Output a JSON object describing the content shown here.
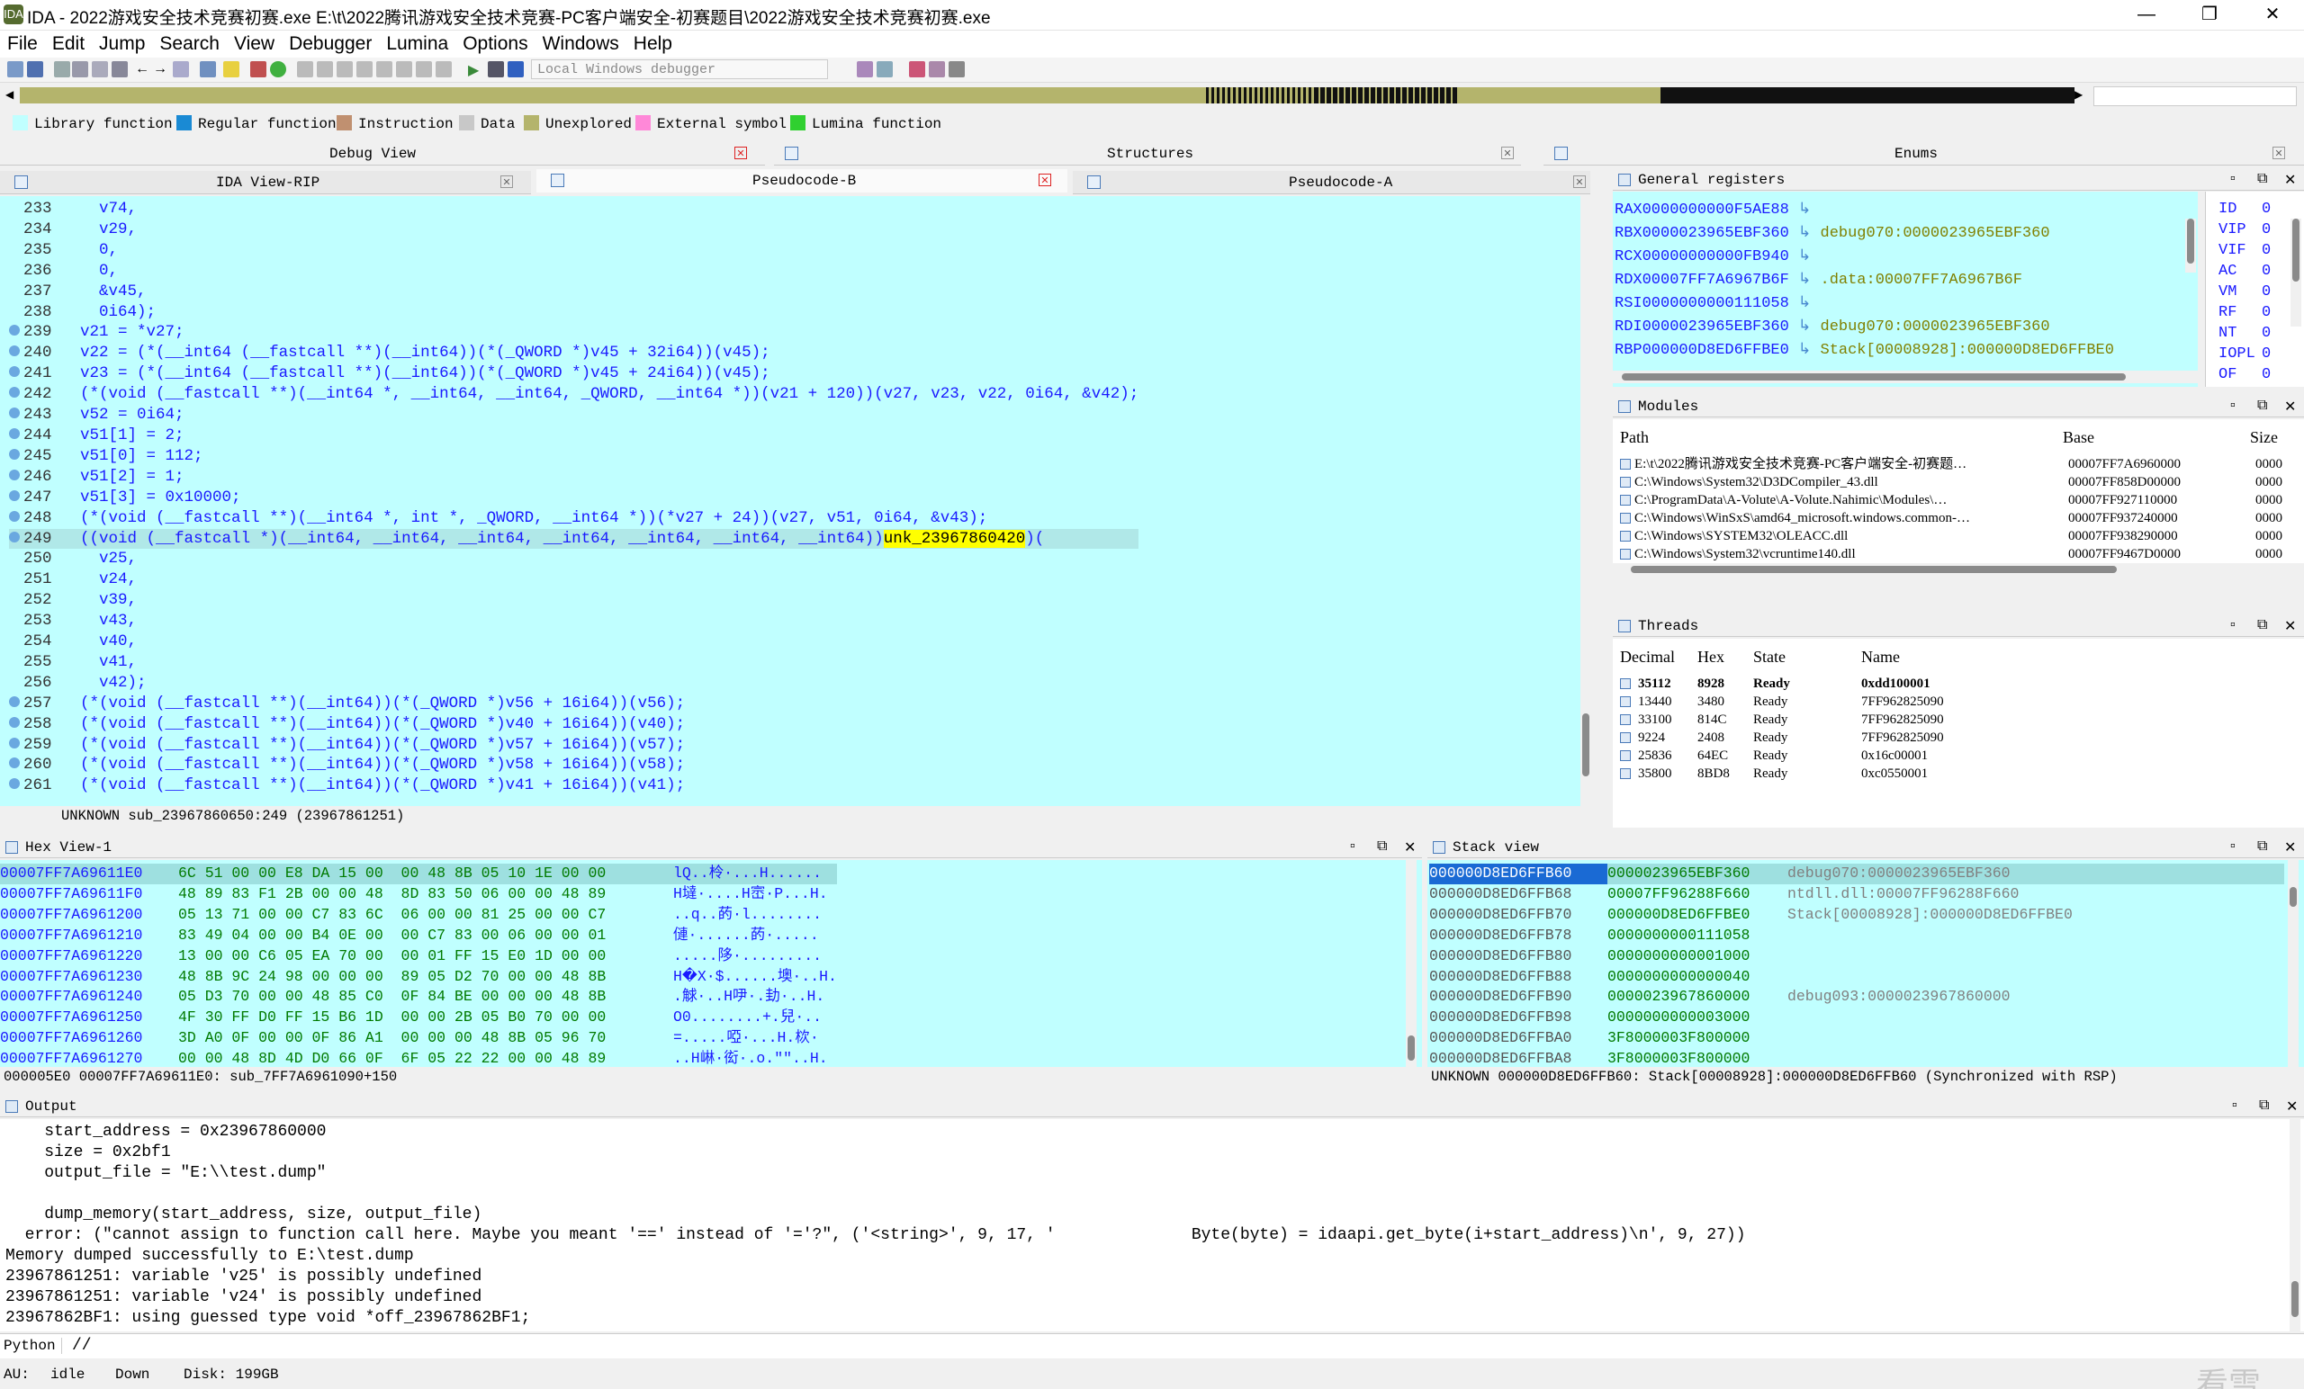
{
  "window": {
    "title": "IDA - 2022游戏安全技术竞赛初赛.exe E:\\t\\2022腾讯游戏安全技术竞赛-PC客户端安全-初赛题目\\2022游戏安全技术竞赛初赛.exe",
    "logo": "IDA"
  },
  "menu": [
    "File",
    "Edit",
    "Jump",
    "Search",
    "View",
    "Debugger",
    "Lumina",
    "Options",
    "Windows",
    "Help"
  ],
  "toolbar": {
    "debugger_select": "Local Windows debugger"
  },
  "legend": [
    {
      "label": "Library function",
      "color": "#c0ffff"
    },
    {
      "label": "Regular function",
      "color": "#1a8ad4"
    },
    {
      "label": "Instruction",
      "color": "#c09070"
    },
    {
      "label": "Data",
      "color": "#c8c8c8"
    },
    {
      "label": "Unexplored",
      "color": "#b4b46c"
    },
    {
      "label": "External symbol",
      "color": "#ff88d8"
    },
    {
      "label": "Lumina function",
      "color": "#30d030"
    }
  ],
  "top_tabs": [
    "Debug View",
    "Structures",
    "Enums"
  ],
  "code_tabs": [
    "IDA View-RIP",
    "Pseudocode-B",
    "Pseudocode-A"
  ],
  "pseudocode": {
    "lines": [
      {
        "n": "233",
        "bp": false,
        "t": "    v74,"
      },
      {
        "n": "234",
        "bp": false,
        "t": "    v29,"
      },
      {
        "n": "235",
        "bp": false,
        "t": "    0,"
      },
      {
        "n": "236",
        "bp": false,
        "t": "    0,"
      },
      {
        "n": "237",
        "bp": false,
        "t": "    &v45,"
      },
      {
        "n": "238",
        "bp": false,
        "t": "    0i64);"
      },
      {
        "n": "239",
        "bp": true,
        "t": "  v21 = *v27;"
      },
      {
        "n": "240",
        "bp": true,
        "t": "  v22 = (*(__int64 (__fastcall **)(__int64))(*(_QWORD *)v45 + 32i64))(v45);"
      },
      {
        "n": "241",
        "bp": true,
        "t": "  v23 = (*(__int64 (__fastcall **)(__int64))(*(_QWORD *)v45 + 24i64))(v45);"
      },
      {
        "n": "242",
        "bp": true,
        "t": "  (*(void (__fastcall **)(__int64 *, __int64, __int64, _QWORD, __int64 *))(v21 + 120))(v27, v23, v22, 0i64, &v42);"
      },
      {
        "n": "243",
        "bp": true,
        "t": "  v52 = 0i64;"
      },
      {
        "n": "244",
        "bp": true,
        "t": "  v51[1] = 2;"
      },
      {
        "n": "245",
        "bp": true,
        "t": "  v51[0] = 112;"
      },
      {
        "n": "246",
        "bp": true,
        "t": "  v51[2] = 1;"
      },
      {
        "n": "247",
        "bp": true,
        "t": "  v51[3] = 0x10000;"
      },
      {
        "n": "248",
        "bp": true,
        "t": "  (*(void (__fastcall **)(__int64 *, int *, _QWORD, __int64 *))(*v27 + 24))(v27, v51, 0i64, &v43);"
      },
      {
        "n": "249",
        "bp": true,
        "t": "  ((void (__fastcall *)(__int64, __int64, __int64, __int64, __int64, __int64, __int64))",
        "hl": "unk_23967860420",
        "tail": ")("
      },
      {
        "n": "250",
        "bp": false,
        "t": "    v25,"
      },
      {
        "n": "251",
        "bp": false,
        "t": "    v24,"
      },
      {
        "n": "252",
        "bp": false,
        "t": "    v39,"
      },
      {
        "n": "253",
        "bp": false,
        "t": "    v43,"
      },
      {
        "n": "254",
        "bp": false,
        "t": "    v40,"
      },
      {
        "n": "255",
        "bp": false,
        "t": "    v41,"
      },
      {
        "n": "256",
        "bp": false,
        "t": "    v42);"
      },
      {
        "n": "257",
        "bp": true,
        "t": "  (*(void (__fastcall **)(__int64))(*(_QWORD *)v56 + 16i64))(v56);"
      },
      {
        "n": "258",
        "bp": true,
        "t": "  (*(void (__fastcall **)(__int64))(*(_QWORD *)v40 + 16i64))(v40);"
      },
      {
        "n": "259",
        "bp": true,
        "t": "  (*(void (__fastcall **)(__int64))(*(_QWORD *)v57 + 16i64))(v57);"
      },
      {
        "n": "260",
        "bp": true,
        "t": "  (*(void (__fastcall **)(__int64))(*(_QWORD *)v58 + 16i64))(v58);"
      },
      {
        "n": "261",
        "bp": true,
        "t": "  (*(void (__fastcall **)(__int64))(*(_QWORD *)v41 + 16i64))(v41);"
      }
    ],
    "status": "UNKNOWN sub_23967860650:249 (23967861251)"
  },
  "registers": {
    "title": "General registers",
    "rows": [
      {
        "r": "RAX",
        "v": "0000000000F5AE88",
        "c": ""
      },
      {
        "r": "RBX",
        "v": "0000023965EBF360",
        "c": "debug070:0000023965EBF360"
      },
      {
        "r": "RCX",
        "v": "00000000000FB940",
        "c": ""
      },
      {
        "r": "RDX",
        "v": "00007FF7A6967B6F",
        "c": ".data:00007FF7A6967B6F"
      },
      {
        "r": "RSI",
        "v": "0000000000111058",
        "c": ""
      },
      {
        "r": "RDI",
        "v": "0000023965EBF360",
        "c": "debug070:0000023965EBF360"
      },
      {
        "r": "RBP",
        "v": "000000D8ED6FFBE0",
        "c": "Stack[00008928]:000000D8ED6FFBE0"
      }
    ],
    "flags": [
      {
        "f": "ID",
        "v": "0"
      },
      {
        "f": "VIP",
        "v": "0"
      },
      {
        "f": "VIF",
        "v": "0"
      },
      {
        "f": "AC",
        "v": "0"
      },
      {
        "f": "VM",
        "v": "0"
      },
      {
        "f": "RF",
        "v": "0"
      },
      {
        "f": "NT",
        "v": "0"
      },
      {
        "f": "IOPL",
        "v": "0"
      },
      {
        "f": "OF",
        "v": "0"
      }
    ]
  },
  "modules": {
    "title": "Modules",
    "headers": [
      "Path",
      "Base",
      "Size"
    ],
    "rows": [
      {
        "p": "E:\\t\\2022腾讯游戏安全技术竞赛-PC客户端安全-初赛题…",
        "b": "00007FF7A6960000",
        "s": "0000"
      },
      {
        "p": "C:\\Windows\\System32\\D3DCompiler_43.dll",
        "b": "00007FF858D00000",
        "s": "0000"
      },
      {
        "p": "C:\\ProgramData\\A-Volute\\A-Volute.Nahimic\\Modules\\…",
        "b": "00007FF927110000",
        "s": "0000"
      },
      {
        "p": "C:\\Windows\\WinSxS\\amd64_microsoft.windows.common-…",
        "b": "00007FF937240000",
        "s": "0000"
      },
      {
        "p": "C:\\Windows\\SYSTEM32\\OLEACC.dll",
        "b": "00007FF938290000",
        "s": "0000"
      },
      {
        "p": "C:\\Windows\\System32\\vcruntime140.dll",
        "b": "00007FF9467D0000",
        "s": "0000"
      }
    ]
  },
  "threads": {
    "title": "Threads",
    "headers": [
      "Decimal",
      "Hex",
      "State",
      "Name"
    ],
    "rows": [
      {
        "d": "35112",
        "h": "8928",
        "s": "Ready",
        "n": "0xdd100001",
        "bold": true
      },
      {
        "d": "13440",
        "h": "3480",
        "s": "Ready",
        "n": "7FF962825090",
        "bold": false
      },
      {
        "d": "33100",
        "h": "814C",
        "s": "Ready",
        "n": "7FF962825090",
        "bold": false
      },
      {
        "d": "9224",
        "h": "2408",
        "s": "Ready",
        "n": "7FF962825090",
        "bold": false
      },
      {
        "d": "25836",
        "h": "64EC",
        "s": "Ready",
        "n": "0x16c00001",
        "bold": false
      },
      {
        "d": "35800",
        "h": "8BD8",
        "s": "Ready",
        "n": "0xc0550001",
        "bold": false
      }
    ]
  },
  "hexview": {
    "title": "Hex View-1",
    "rows": [
      {
        "a": "00007FF7A69611E0",
        "b": "6C 51 00 00 E8 DA 15 00  00 48 8B 05 10 1E 00 00",
        "s": "lQ..柃·...H......"
      },
      {
        "a": "00007FF7A69611F0",
        "b": "48 89 83 F1 2B 00 00 48  8D 83 50 06 00 00 48 89",
        "s": "H墶·....H崈·P...H."
      },
      {
        "a": "00007FF7A6961200",
        "b": "05 13 71 00 00 C7 83 6C  06 00 00 81 25 00 00 C7",
        "s": "..q..菂·l........"
      },
      {
        "a": "00007FF7A6961210",
        "b": "83 49 04 00 00 B4 0E 00  00 C7 83 00 06 00 00 01",
        "s": "僆·......菂·....."
      },
      {
        "a": "00007FF7A6961220",
        "b": "13 00 00 C6 05 EA 70 00  00 01 FF 15 E0 1D 00 00",
        "s": ".....陊·........."
      },
      {
        "a": "00007FF7A6961230",
        "b": "48 8B 9C 24 98 00 00 00  89 05 D2 70 00 00 48 8B",
        "s": "H�X·$......墺·..H."
      },
      {
        "a": "00007FF7A6961240",
        "b": "05 D3 70 00 00 48 85 C0  0F 84 BE 00 00 00 48 8B",
        "s": ".觩·..H吚·.劸·..H."
      },
      {
        "a": "00007FF7A6961250",
        "b": "4F 30 FF D0 FF 15 B6 1D  00 00 2B 05 B0 70 00 00",
        "s": "O0........+.兒·.."
      },
      {
        "a": "00007FF7A6961260",
        "b": "3D A0 0F 00 00 0F 86 A1  00 00 00 48 8B 05 96 70",
        "s": "=.....啞·...H.栨·"
      },
      {
        "a": "00007FF7A6961270",
        "b": "00 00 48 8D 4D D0 66 0F  6F 05 22 22 00 00 48 89",
        "s": "..H崊·衒·.o.\"\"..H."
      }
    ],
    "status": "000005E0 00007FF7A69611E0: sub_7FF7A6961090+150"
  },
  "stackview": {
    "title": "Stack view",
    "rows": [
      {
        "a": "000000D8ED6FFB60",
        "v": "0000023965EBF360",
        "c": "debug070:0000023965EBF360",
        "sel": true
      },
      {
        "a": "000000D8ED6FFB68",
        "v": "00007FF96288F660",
        "c": "ntdll.dll:00007FF96288F660",
        "sel": false
      },
      {
        "a": "000000D8ED6FFB70",
        "v": "000000D8ED6FFBE0",
        "c": "Stack[00008928]:000000D8ED6FFBE0",
        "sel": false
      },
      {
        "a": "000000D8ED6FFB78",
        "v": "0000000000111058",
        "c": "",
        "sel": false
      },
      {
        "a": "000000D8ED6FFB80",
        "v": "0000000000001000",
        "c": "",
        "sel": false
      },
      {
        "a": "000000D8ED6FFB88",
        "v": "0000000000000040",
        "c": "",
        "sel": false
      },
      {
        "a": "000000D8ED6FFB90",
        "v": "0000023967860000",
        "c": "debug093:0000023967860000",
        "sel": false
      },
      {
        "a": "000000D8ED6FFB98",
        "v": "0000000000003000",
        "c": "",
        "sel": false
      },
      {
        "a": "000000D8ED6FFBA0",
        "v": "3F8000003F800000",
        "c": "",
        "sel": false
      },
      {
        "a": "000000D8ED6FFBA8",
        "v": "3F8000003F800000",
        "c": "",
        "sel": false
      }
    ],
    "status": "UNKNOWN 000000D8ED6FFB60: Stack[00008928]:000000D8ED6FFB60 (Synchronized with RSP)"
  },
  "output": {
    "title": "Output",
    "lines": [
      "    start_address = 0x23967860000",
      "    size = 0x2bf1",
      "    output_file = \"E:\\\\test.dump\"",
      "",
      "    dump_memory(start_address, size, output_file)",
      "  error: (\"cannot assign to function call here. Maybe you meant '==' instead of '='?\", ('<string>', 9, 17, '              Byte(byte) = idaapi.get_byte(i+start_address)\\n', 9, 27))",
      "Memory dumped successfully to E:\\test.dump",
      "23967861251: variable 'v25' is possibly undefined",
      "23967861251: variable 'v24' is possibly undefined",
      "23967862BF1: using guessed type void *off_23967862BF1;"
    ],
    "input_lang": "Python",
    "input_value": "//"
  },
  "statusbar": {
    "au": "AU:",
    "au_state": "idle",
    "dir": "Down",
    "disk": "Disk: 199GB"
  },
  "watermark": "看雪"
}
